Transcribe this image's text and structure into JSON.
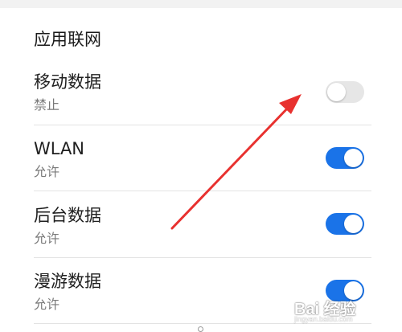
{
  "section": {
    "title": "应用联网"
  },
  "rows": [
    {
      "title": "移动数据",
      "status": "禁止",
      "enabled": false
    },
    {
      "title": "WLAN",
      "status": "允许",
      "enabled": true
    },
    {
      "title": "后台数据",
      "status": "允许",
      "enabled": true
    },
    {
      "title": "漫游数据",
      "status": "允许",
      "enabled": true
    }
  ],
  "colors": {
    "switch_on": "#1a73e8",
    "switch_off": "#e6e6e6",
    "annotation_arrow": "#e8312f"
  },
  "watermark": {
    "brand": "Bai 经验",
    "sub": "jingyan.baidu.com"
  }
}
